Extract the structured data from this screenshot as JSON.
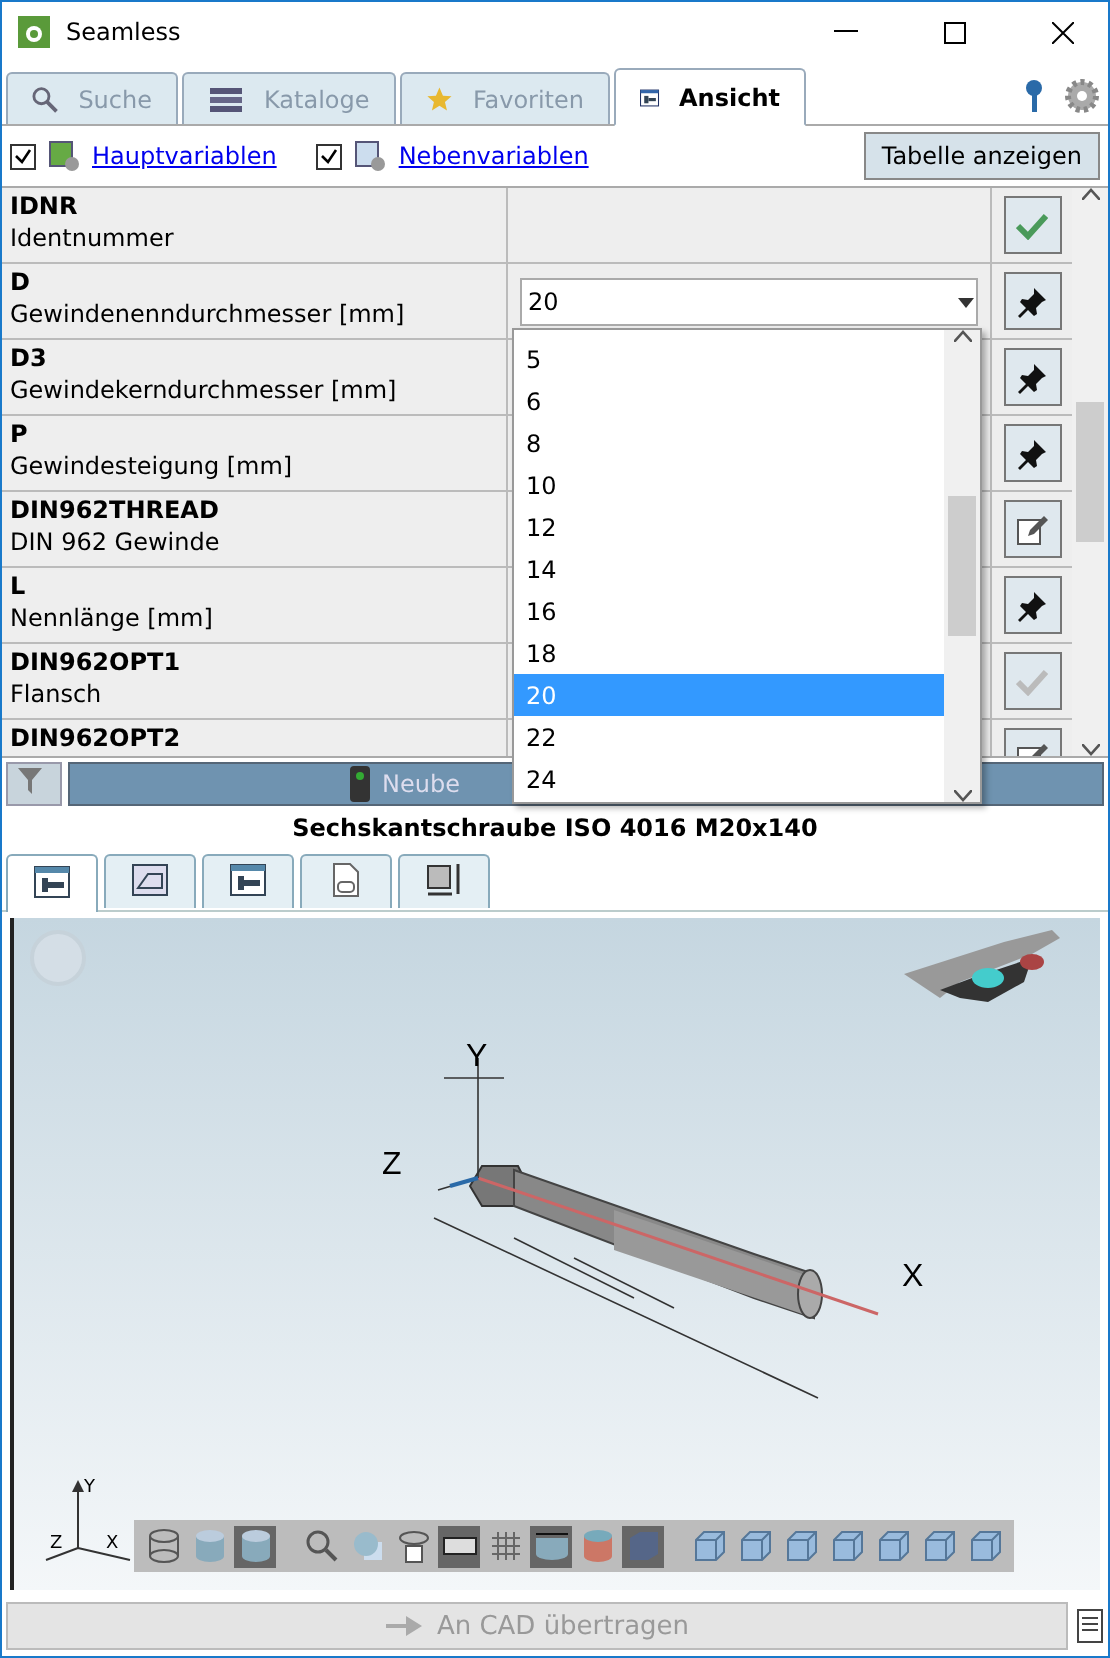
{
  "window": {
    "title": "Seamless"
  },
  "tabs": [
    {
      "label": "Suche",
      "selected": false
    },
    {
      "label": "Kataloge",
      "selected": false
    },
    {
      "label": "Favoriten",
      "selected": false
    },
    {
      "label": "Ansicht",
      "selected": true
    }
  ],
  "options": [
    {
      "label": "Hauptvariablen",
      "checked": true
    },
    {
      "label": "Nebenvariablen",
      "checked": true
    }
  ],
  "table_button": "Tabelle anzeigen",
  "rows": [
    {
      "name": "IDNR",
      "description": "Identnummer",
      "action": {
        "kind": "check",
        "disabled": false
      }
    },
    {
      "name": "D",
      "description": "Gewindenenndurchmesser [mm]",
      "value": "20",
      "action": {
        "kind": "pin",
        "disabled": false
      }
    },
    {
      "name": "D3",
      "description": "Gewindekerndurchmesser [mm]",
      "action": {
        "kind": "pin",
        "disabled": false
      }
    },
    {
      "name": "P",
      "description": "Gewindesteigung [mm]",
      "action": {
        "kind": "pin",
        "disabled": false
      }
    },
    {
      "name": "DIN962THREAD",
      "description": "DIN 962 Gewinde",
      "action": {
        "kind": "edit",
        "disabled": false
      }
    },
    {
      "name": "L",
      "description": "Nennlänge [mm]",
      "action": {
        "kind": "pin",
        "disabled": false
      }
    },
    {
      "name": "DIN962OPT1",
      "description": "Flansch",
      "action": {
        "kind": "check",
        "disabled": true
      }
    },
    {
      "name": "DIN962OPT2",
      "action": {
        "kind": "edit",
        "disabled": false
      }
    }
  ],
  "dropdown": {
    "options": [
      {
        "label": "5",
        "selected": false
      },
      {
        "label": "6",
        "selected": false
      },
      {
        "label": "8",
        "selected": false
      },
      {
        "label": "10",
        "selected": false
      },
      {
        "label": "12",
        "selected": false
      },
      {
        "label": "14",
        "selected": false
      },
      {
        "label": "16",
        "selected": false
      },
      {
        "label": "18",
        "selected": false
      },
      {
        "label": "20",
        "selected": true
      },
      {
        "label": "22",
        "selected": false
      },
      {
        "label": "24",
        "selected": false
      }
    ]
  },
  "regenerate_button": "Neube",
  "part_title": "Sechskantschraube ISO 4016 M20x140",
  "view_tabs": [
    {
      "selected": true
    },
    {
      "selected": false
    },
    {
      "selected": false
    },
    {
      "selected": false
    },
    {
      "selected": false
    }
  ],
  "viewport": {
    "axes": {
      "x": "X",
      "y": "Y",
      "z": "Z"
    },
    "triad": {
      "x": "X",
      "y": "Y",
      "z": "Z"
    },
    "toolbar": [
      {
        "selected": false
      },
      {
        "selected": false
      },
      {
        "selected": true
      },
      {
        "selected": false
      },
      {
        "selected": false
      },
      {
        "selected": false
      },
      {
        "selected": true
      },
      {
        "selected": false
      },
      {
        "selected": true
      },
      {
        "selected": false
      },
      {
        "selected": true
      },
      {
        "selected": false
      },
      {
        "selected": false
      },
      {
        "selected": false
      },
      {
        "selected": false
      },
      {
        "selected": false
      },
      {
        "selected": false
      },
      {
        "selected": false
      }
    ]
  },
  "cad_button": "An CAD übertragen"
}
